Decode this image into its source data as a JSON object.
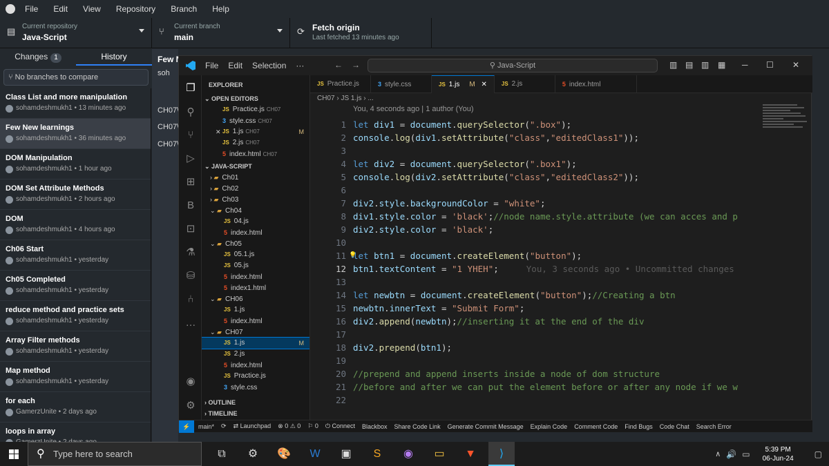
{
  "gh": {
    "menu": [
      "File",
      "Edit",
      "View",
      "Repository",
      "Branch",
      "Help"
    ],
    "repo_label": "Current repository",
    "repo_value": "Java-Script",
    "branch_label": "Current branch",
    "branch_value": "main",
    "fetch_label": "Fetch origin",
    "fetch_sub": "Last fetched 13 minutes ago",
    "tab_changes": "Changes",
    "tab_changes_count": "1",
    "tab_history": "History",
    "compare_placeholder": "No branches to compare",
    "right_title": "Few N",
    "right_user": "soh",
    "right_rows": [
      "CH07\\",
      "CH07\\",
      "CH07\\"
    ],
    "commits": [
      {
        "title": "Class List and more manipulation",
        "sub": "sohamdeshmukh1 • 13 minutes ago"
      },
      {
        "title": "Few New learnings",
        "sub": "sohamdeshmukh1 • 36 minutes ago"
      },
      {
        "title": "DOM Manipulation",
        "sub": "sohamdeshmukh1 • 1 hour ago"
      },
      {
        "title": "DOM Set Attribute Methods",
        "sub": "sohamdeshmukh1 • 2 hours ago"
      },
      {
        "title": "DOM",
        "sub": "sohamdeshmukh1 • 4 hours ago"
      },
      {
        "title": "Ch06 Start",
        "sub": "sohamdeshmukh1 • yesterday"
      },
      {
        "title": "Ch05 Completed",
        "sub": "sohamdeshmukh1 • yesterday"
      },
      {
        "title": "reduce method and practice sets",
        "sub": "sohamdeshmukh1 • yesterday"
      },
      {
        "title": "Array Filter methods",
        "sub": "sohamdeshmukh1 • yesterday"
      },
      {
        "title": "Map method",
        "sub": "sohamdeshmukh1 • yesterday"
      },
      {
        "title": "for each",
        "sub": "GamerzUnite • 2 days ago"
      },
      {
        "title": "loops in array",
        "sub": "GamerzUnite • 2 days ago"
      }
    ]
  },
  "vs": {
    "menu": [
      "File",
      "Edit",
      "Selection",
      "···"
    ],
    "search": "Java-Script",
    "explorer_title": "EXPLORER",
    "open_editors": "OPEN EDITORS",
    "open_files": [
      {
        "icon": "JS",
        "name": "Practice.js",
        "dir": "CH07",
        "mod": ""
      },
      {
        "icon": "CSS",
        "name": "style.css",
        "dir": "CH07",
        "mod": ""
      },
      {
        "icon": "JS",
        "name": "1.js",
        "dir": "CH07",
        "mod": "M"
      },
      {
        "icon": "JS",
        "name": "2.js",
        "dir": "CH07",
        "mod": ""
      },
      {
        "icon": "HTML",
        "name": "index.html",
        "dir": "CH07",
        "mod": ""
      }
    ],
    "workspace": "JAVA-SCRIPT",
    "tree": [
      {
        "t": "folder",
        "name": "Ch01",
        "lvl": 1,
        "open": false
      },
      {
        "t": "folder",
        "name": "Ch02",
        "lvl": 1,
        "open": false
      },
      {
        "t": "folder",
        "name": "Ch03",
        "lvl": 1,
        "open": false
      },
      {
        "t": "folder",
        "name": "Ch04",
        "lvl": 1,
        "open": true
      },
      {
        "t": "JS",
        "name": "04.js",
        "lvl": 2
      },
      {
        "t": "HTML",
        "name": "index.html",
        "lvl": 2
      },
      {
        "t": "folder",
        "name": "Ch05",
        "lvl": 1,
        "open": true
      },
      {
        "t": "JS",
        "name": "05.1.js",
        "lvl": 2
      },
      {
        "t": "JS",
        "name": "05.js",
        "lvl": 2
      },
      {
        "t": "HTML",
        "name": "index.html",
        "lvl": 2
      },
      {
        "t": "HTML",
        "name": "index1.html",
        "lvl": 2
      },
      {
        "t": "folder",
        "name": "CH06",
        "lvl": 1,
        "open": true
      },
      {
        "t": "JS",
        "name": "1.js",
        "lvl": 2
      },
      {
        "t": "HTML",
        "name": "index.html",
        "lvl": 2
      },
      {
        "t": "folder",
        "name": "CH07",
        "lvl": 1,
        "open": true
      },
      {
        "t": "JS",
        "name": "1.js",
        "lvl": 2,
        "sel": true,
        "mod": "M"
      },
      {
        "t": "JS",
        "name": "2.js",
        "lvl": 2
      },
      {
        "t": "HTML",
        "name": "index.html",
        "lvl": 2
      },
      {
        "t": "JS",
        "name": "Practice.js",
        "lvl": 2
      },
      {
        "t": "CSS",
        "name": "style.css",
        "lvl": 2
      }
    ],
    "outline": "OUTLINE",
    "timeline": "TIMELINE",
    "tabs": [
      {
        "icon": "JS",
        "name": "Practice.js"
      },
      {
        "icon": "CSS",
        "name": "style.css"
      },
      {
        "icon": "JS",
        "name": "1.js",
        "mod": "M",
        "active": true
      },
      {
        "icon": "JS",
        "name": "2.js"
      },
      {
        "icon": "HTML",
        "name": "index.html"
      }
    ],
    "breadcrumb": "CH07 › JS 1.js › ...",
    "blame": "You, 4 seconds ago | 1 author (You)",
    "ghost": "You, 3 seconds ago • Uncommitted changes",
    "current_line": 12,
    "lines": [
      "let div1 = document.querySelector(\".box\");",
      "console.log(div1.setAttribute(\"class\",\"editedClass1\"));",
      "",
      "let div2 = document.querySelector(\".box1\");",
      "console.log(div2.setAttribute(\"class\",\"editedClass2\"));",
      "",
      "div2.style.backgroundColor = \"white\";",
      "div1.style.color = 'black';//node name.style.attribute (we can acces and p",
      "div2.style.color = 'black';",
      "",
      "let btn1 = document.createElement(\"button\");",
      "btn1.textContent = \"1 YHEH\";",
      "",
      "let newbtn = document.createElement(\"button\");//Creating a btn",
      "newbtn.innerText = \"Submit Form\";",
      "div2.append(newbtn);//inserting it at the end of the div",
      "",
      "div2.prepend(btn1);",
      "",
      "//prepend and append inserts inside a node of dom structure",
      "//before and after we can put the element before or after any node if we w",
      ""
    ],
    "status": [
      "main*",
      "⟳",
      "⇄ Launchpad",
      "⊗ 0 ⚠ 0",
      "⚐ 0",
      "⏻ Connect",
      "Blackbox",
      "Share Code Link",
      "Generate Commit Message",
      "Explain Code",
      "Comment Code",
      "Find Bugs",
      "Code Chat",
      "Search Error"
    ]
  },
  "taskbar": {
    "search_placeholder": "Type here to search",
    "time": "5:39 PM",
    "date": "06-Jun-24"
  }
}
